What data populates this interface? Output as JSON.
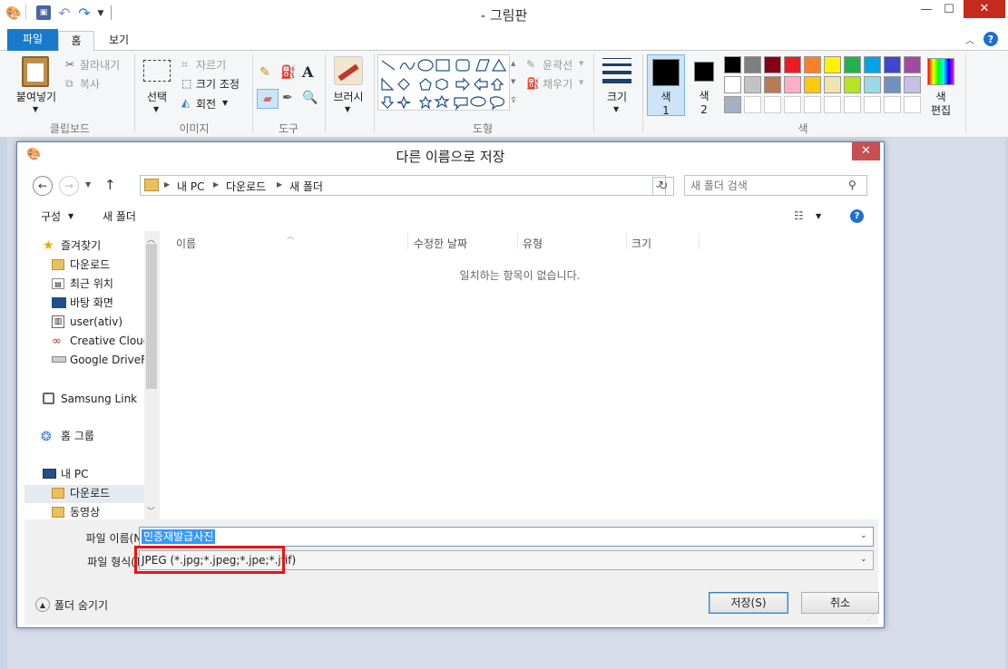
{
  "app": {
    "title": "- 그림판",
    "minimize": "—",
    "maximize": "☐",
    "close": "✕",
    "help": "?"
  },
  "ribbon_tabs": [
    "파일",
    "홈",
    "보기"
  ],
  "ribbon": {
    "clipboard": {
      "paste": "붙여넣기",
      "cut": "잘라내기",
      "copy": "복사",
      "label": "클립보드"
    },
    "image": {
      "select": "선택",
      "crop": "자르기",
      "resize": "크기 조정",
      "rotate": "회전",
      "label": "이미지"
    },
    "tools": {
      "label": "도구"
    },
    "brushes": {
      "label": "브러시"
    },
    "shapes": {
      "outline": "윤곽선",
      "fill": "채우기",
      "label": "도형"
    },
    "size": {
      "label": "크기"
    },
    "colors": {
      "color1": "색\n1",
      "color1_a": "색",
      "color1_b": "1",
      "color2_a": "색",
      "color2_b": "2",
      "edit_a": "색",
      "edit_b": "편집",
      "label": "색",
      "row1": [
        "#000000",
        "#7f7f7f",
        "#880015",
        "#ed1c24",
        "#ff7f27",
        "#fff200",
        "#22b14c",
        "#00a2e8",
        "#3f48cc",
        "#a349a4"
      ],
      "row2": [
        "#ffffff",
        "#c3c3c3",
        "#b97a57",
        "#ffaec9",
        "#ffc90e",
        "#efe4b0",
        "#b5e61d",
        "#99d9ea",
        "#7092be",
        "#c8bfe7"
      ],
      "row3": [
        "#a6b0c3",
        "#ffffff",
        "#ffffff",
        "#ffffff",
        "#ffffff",
        "#ffffff",
        "#ffffff",
        "#ffffff",
        "#ffffff",
        "#ffffff"
      ]
    }
  },
  "dialog": {
    "title": "다른 이름으로 저장",
    "path": [
      "내 PC",
      "다운로드",
      "새 폴더"
    ],
    "search_placeholder": "새 폴더 검색",
    "organize": "구성",
    "new_folder": "새 폴더",
    "columns": [
      "이름",
      "수정한 날짜",
      "유형",
      "크기"
    ],
    "empty_message": "일치하는 항목이 없습니다.",
    "nav": {
      "favorites": "즐겨찾기",
      "fav_items": [
        "다운로드",
        "최근 위치",
        "바탕 화면",
        "user(ativ)",
        "Creative Cloud",
        "Google DriveFS"
      ],
      "samsung": "Samsung Link",
      "homegroup": "홈 그룹",
      "pc": "내 PC",
      "pc_items": [
        "다운로드",
        "동영상"
      ]
    },
    "filename_label": "파일 이름(N):",
    "filename_value": "민증재발급사진",
    "filetype_label": "파일 형식(T):",
    "filetype_value": "JPEG (*.jpg;*.jpeg;*.jpe;*.jfif)",
    "hide_folders": "폴더 숨기기",
    "save": "저장(S)",
    "cancel": "취소"
  }
}
